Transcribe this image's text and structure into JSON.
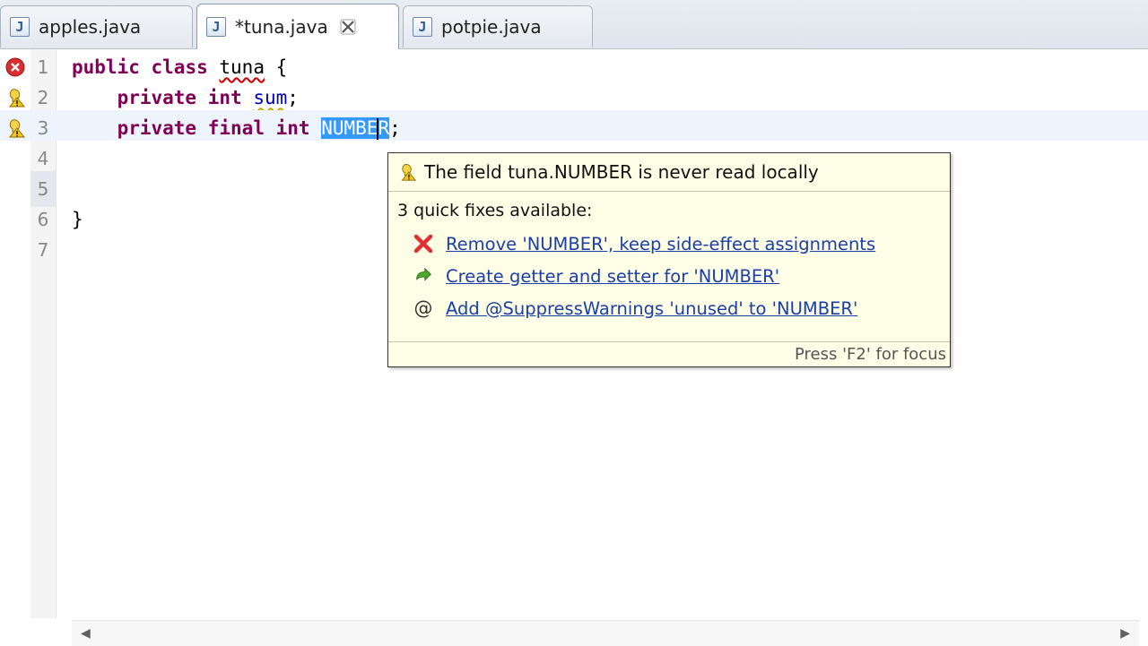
{
  "tabs": [
    {
      "label": "apples.java",
      "active": false
    },
    {
      "label": "*tuna.java",
      "active": true
    },
    {
      "label": "potpie.java",
      "active": false
    }
  ],
  "tab_icon_glyph": "J",
  "code_lines": [
    {
      "num": "1",
      "annotation": "error-icon"
    },
    {
      "num": "2",
      "annotation": "warning-lightbulb-icon"
    },
    {
      "num": "3",
      "annotation": "warning-lightbulb-icon"
    },
    {
      "num": "4"
    },
    {
      "num": "5"
    },
    {
      "num": "6"
    },
    {
      "num": "7"
    }
  ],
  "code": {
    "l1_kw1": "public",
    "l1_kw2": "class",
    "l1_name": "tuna",
    "l1_brace": "{",
    "l2_kw1": "private",
    "l2_kw2": "int",
    "l2_name": "sum",
    "l2_semi": ";",
    "l3_kw1": "private",
    "l3_kw2": "final",
    "l3_kw3": "int",
    "l3_name_a": "NUMBE",
    "l3_name_b": "R",
    "l3_semi": ";",
    "l6_brace": "}"
  },
  "popup": {
    "header": "The field tuna.NUMBER is never read locally",
    "subheader": "3 quick fixes available:",
    "fixes": [
      {
        "label": "Remove 'NUMBER', keep side-effect assignments",
        "icon": "remove-x-icon"
      },
      {
        "label": "Create getter and setter for 'NUMBER'",
        "icon": "green-arrow-icon"
      },
      {
        "label": "Add @SuppressWarnings 'unused' to 'NUMBER'",
        "icon": "at-sign-icon"
      }
    ],
    "footer": "Press 'F2' for focus",
    "at_glyph": "@"
  },
  "colors": {
    "keyword": "#7f0055",
    "selection": "#3399ff",
    "popup_bg": "#fefee6",
    "link": "#1a3fa8",
    "error": "#d40000"
  }
}
